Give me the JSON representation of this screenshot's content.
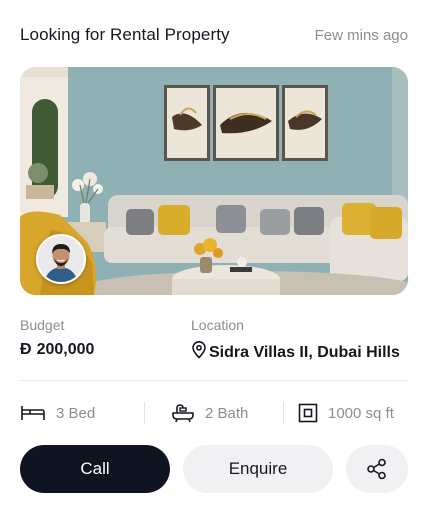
{
  "header": {
    "title": "Looking for Rental Property",
    "time": "Few mins ago"
  },
  "listing": {
    "photo_description": "living-room-photo",
    "budget_label": "Budget",
    "budget_currency_glyph": "Đ",
    "budget_value": "200,000",
    "location_label": "Location",
    "location_value": "Sidra Villas II, Dubai Hills"
  },
  "features": {
    "beds": "3 Bed",
    "baths": "2 Bath",
    "area": "1000 sq ft"
  },
  "actions": {
    "call_label": "Call",
    "enquire_label": "Enquire",
    "share_icon": "share-icon"
  },
  "colors": {
    "primary_button": "#0e1420",
    "secondary_button": "#f1f1f3",
    "muted_text": "#8a8d94",
    "wall": "#8fb1b4"
  }
}
